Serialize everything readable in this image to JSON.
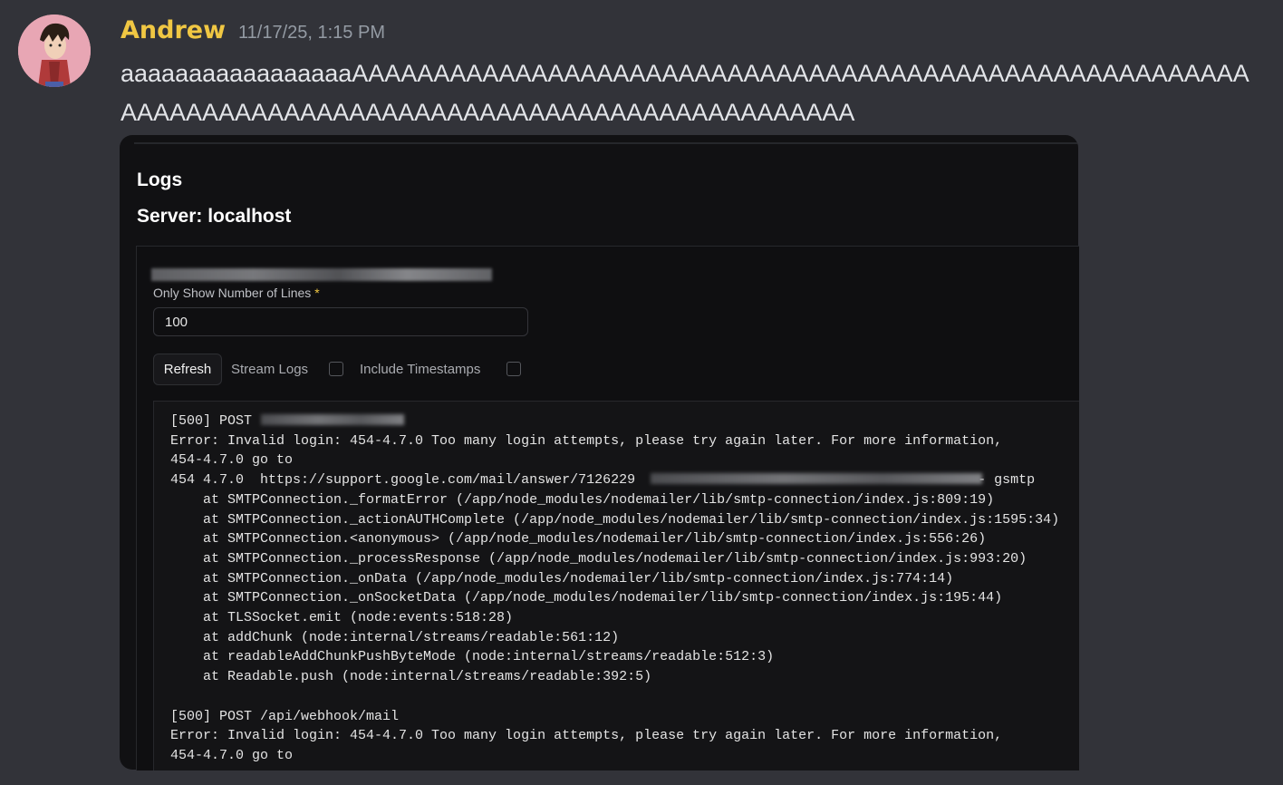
{
  "message": {
    "username": "Andrew",
    "timestamp": "11/17/25, 1:15 PM",
    "text": "aaaaaaaaaaaaaaaaaAAAAAAAAAAAAAAAAAAAAAAAAAAAAAAAAAAAAAAAAAAAAAAAAAAAAAAAAAAAAAAAAAAAAAAAAAAAAAAAAAAAAAAAAAAAAAAAAAAAA"
  },
  "embed": {
    "title": "Logs",
    "subtitle": "Server: localhost",
    "lines_label": "Only Show Number of Lines",
    "required_mark": "*",
    "lines_value": "100",
    "refresh_label": "Refresh",
    "stream_logs_label": "Stream Logs",
    "include_timestamps_label": "Include Timestamps",
    "log_lines": [
      "[500] POST ",
      "Error: Invalid login: 454-4.7.0 Too many login attempts, please try again later. For more information,",
      "454-4.7.0 go to",
      "454 4.7.0  https://support.google.com/mail/answer/7126229                                          - gsmtp",
      "    at SMTPConnection._formatError (/app/node_modules/nodemailer/lib/smtp-connection/index.js:809:19)",
      "    at SMTPConnection._actionAUTHComplete (/app/node_modules/nodemailer/lib/smtp-connection/index.js:1595:34)",
      "    at SMTPConnection.<anonymous> (/app/node_modules/nodemailer/lib/smtp-connection/index.js:556:26)",
      "    at SMTPConnection._processResponse (/app/node_modules/nodemailer/lib/smtp-connection/index.js:993:20)",
      "    at SMTPConnection._onData (/app/node_modules/nodemailer/lib/smtp-connection/index.js:774:14)",
      "    at SMTPConnection._onSocketData (/app/node_modules/nodemailer/lib/smtp-connection/index.js:195:44)",
      "    at TLSSocket.emit (node:events:518:28)",
      "    at addChunk (node:internal/streams/readable:561:12)",
      "    at readableAddChunkPushByteMode (node:internal/streams/readable:512:3)",
      "    at Readable.push (node:internal/streams/readable:392:5)",
      "",
      "[500] POST /api/webhook/mail",
      "Error: Invalid login: 454-4.7.0 Too many login attempts, please try again later. For more information,",
      "454-4.7.0 go to"
    ]
  },
  "colors": {
    "background": "#323339",
    "username": "#f0c743",
    "embed_bg": "#111113",
    "required": "#f0c743"
  },
  "icons": [
    "avatar-cartoon"
  ]
}
